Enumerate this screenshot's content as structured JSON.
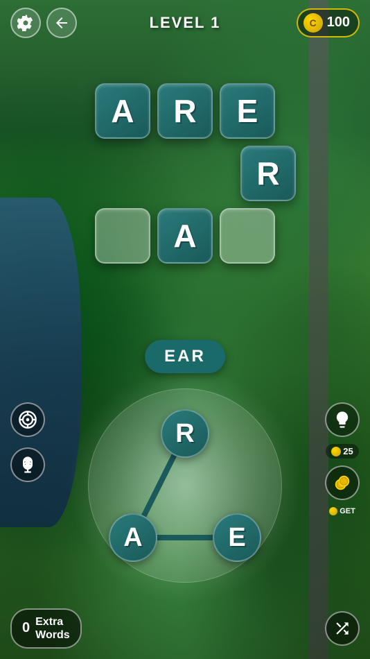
{
  "header": {
    "level_label": "LEVEL 1",
    "coin_count": "100",
    "coin_symbol": "C"
  },
  "tiles": {
    "row1": [
      "A",
      "R",
      "E"
    ],
    "row2": [
      "R"
    ],
    "row3": [
      "",
      "A",
      ""
    ]
  },
  "word_display": {
    "current_word": "EAR"
  },
  "wheel": {
    "letters": [
      "R",
      "A",
      "E"
    ]
  },
  "bottom": {
    "extra_count": "0",
    "extra_label": "Extra\nWords"
  },
  "right_panel": {
    "hint_cost": "25",
    "get_label": "GET"
  }
}
